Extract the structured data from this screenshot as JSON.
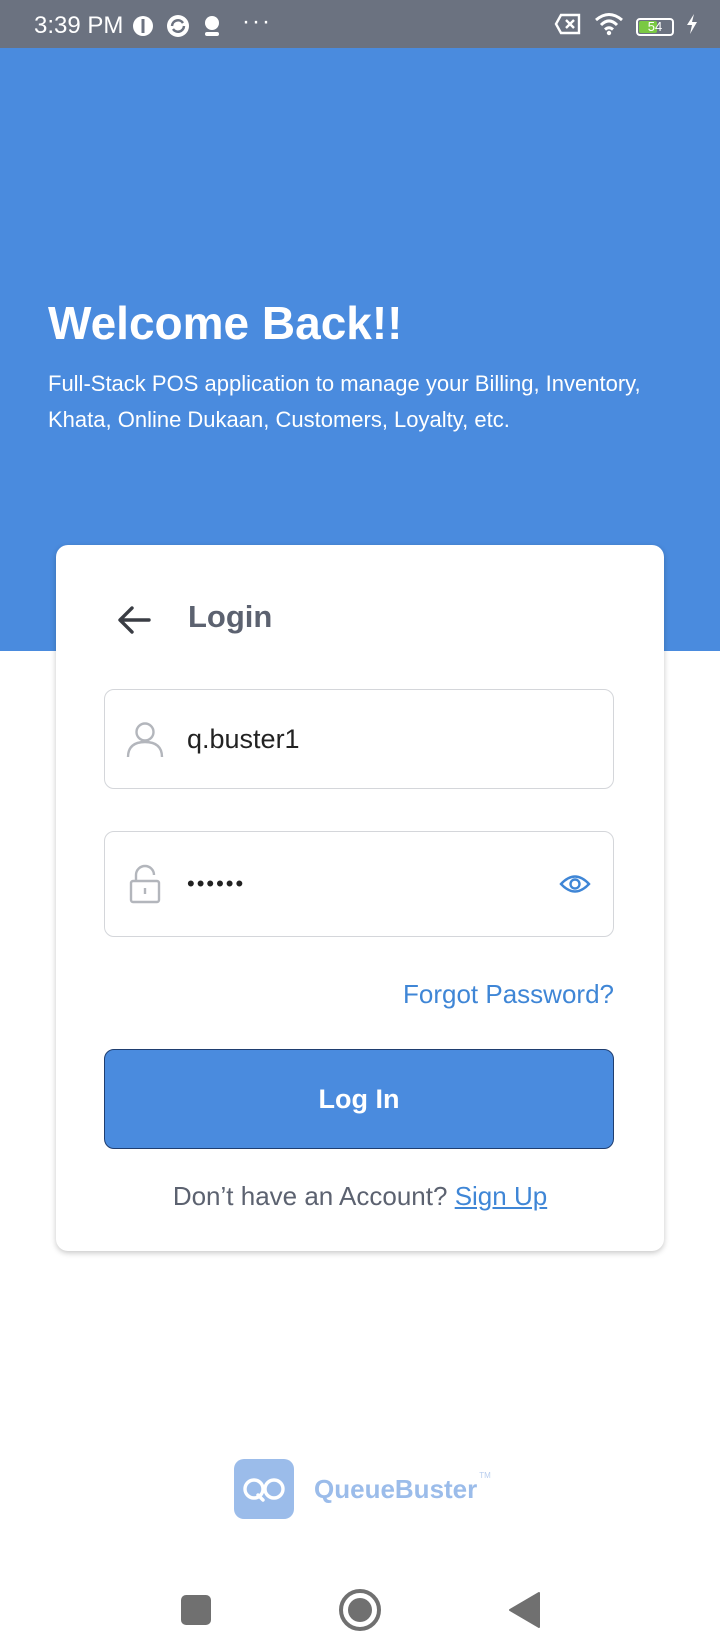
{
  "status_bar": {
    "time": "3:39 PM",
    "overflow_dots": "···",
    "battery_level": "54",
    "icons": [
      "app-notification-icon",
      "sync-icon",
      "profile-icon",
      "no-sim-icon",
      "wifi-icon",
      "battery-icon",
      "charging-icon"
    ]
  },
  "hero": {
    "title": "Welcome Back!!",
    "subtitle": "Full-Stack POS application to manage your Billing, Inventory, Khata, Online Dukaan, Customers, Loyalty, etc."
  },
  "login_card": {
    "title": "Login",
    "username_value": "q.buster1",
    "password_value": "••••••",
    "forgot_password": "Forgot Password?",
    "login_button": "Log In",
    "no_account_text": "Don’t have an Account?",
    "signup_link": "Sign Up"
  },
  "brand": {
    "name": "QueueBuster",
    "trademark": "TM"
  },
  "colors": {
    "primary": "#4a8bde",
    "link": "#3f86d6",
    "status_bar": "#6b7280",
    "muted_text": "#5c6270",
    "brand_light": "#9bbcea"
  }
}
